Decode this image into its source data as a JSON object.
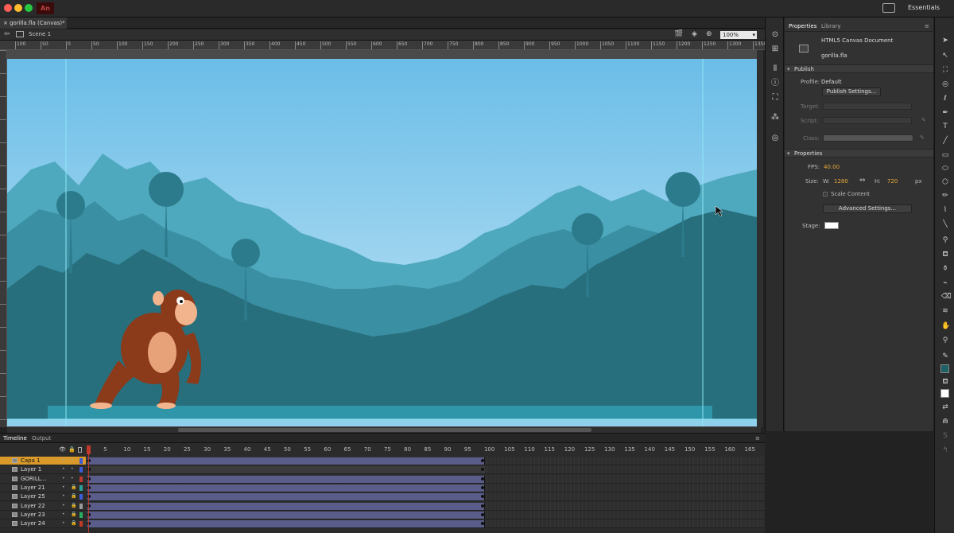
{
  "app": {
    "logo": "An",
    "workspace": "Essentials",
    "colors": {
      "accent": "#e8a93a",
      "stage_bg": "#6dbde6",
      "red": "#c0392b"
    }
  },
  "document": {
    "tab_title": "gorilla.fla (Canvas)*",
    "scene": "Scene 1",
    "zoom": "100%"
  },
  "ruler": {
    "top": [
      "100",
      "50",
      "0",
      "50",
      "100",
      "150",
      "200",
      "250",
      "300",
      "350",
      "400",
      "450",
      "500",
      "550",
      "600",
      "650",
      "700",
      "750",
      "800",
      "850",
      "900",
      "950",
      "1000",
      "1050",
      "1100",
      "1150",
      "1200",
      "1250",
      "1300",
      "1350"
    ],
    "left": [
      "100",
      "50",
      "0",
      "50",
      "100",
      "150",
      "200",
      "250",
      "300",
      "350",
      "400",
      "450",
      "500",
      "550",
      "600",
      "650",
      "700"
    ]
  },
  "properties": {
    "tabs": [
      "Properties",
      "Library"
    ],
    "doc_type": "HTML5 Canvas Document",
    "file_name": "gorilla.fla",
    "publish": {
      "header": "Publish",
      "profile_label": "Profile:",
      "profile_value": "Default",
      "settings_button": "Publish Settings...",
      "target_label": "Target:",
      "script_label": "Script:",
      "class_label": "Class:"
    },
    "props": {
      "header": "Properties",
      "fps_label": "FPS:",
      "fps_value": "40.00",
      "size_label": "Size:",
      "w_label": "W:",
      "w_value": "1280",
      "h_label": "H:",
      "h_value": "720",
      "unit": "px",
      "scale_content": "Scale Content",
      "advanced_button": "Advanced Settings...",
      "stage_label": "Stage:"
    }
  },
  "timeline": {
    "tabs": [
      "Timeline",
      "Output"
    ],
    "frame_numbers": [
      "1",
      "5",
      "10",
      "15",
      "20",
      "25",
      "30",
      "35",
      "40",
      "45",
      "50",
      "55",
      "60",
      "65",
      "70",
      "75",
      "80",
      "85",
      "90",
      "95",
      "100",
      "105",
      "110",
      "115",
      "120",
      "125",
      "130",
      "135",
      "140",
      "145",
      "150",
      "155",
      "160",
      "165"
    ],
    "layers": [
      {
        "name": "Capa 1",
        "color": "#3c5bd6",
        "active": true
      },
      {
        "name": "Layer 1",
        "color": "#3c5bd6",
        "active": false
      },
      {
        "name": "GORILL...",
        "color": "#c0392b",
        "active": false
      },
      {
        "name": "Layer 21",
        "color": "#2aa198",
        "active": false
      },
      {
        "name": "Layer 25",
        "color": "#3c5bd6",
        "active": false
      },
      {
        "name": "Layer 22",
        "color": "#999999",
        "active": false
      },
      {
        "name": "Layer 23",
        "color": "#27ae60",
        "active": false
      },
      {
        "name": "Layer 24",
        "color": "#c0392b",
        "active": false
      }
    ]
  }
}
